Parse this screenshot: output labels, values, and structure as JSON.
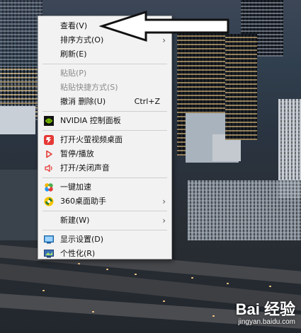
{
  "context_menu": {
    "items": [
      {
        "label": "查看(V)"
      },
      {
        "label": "排序方式(O)"
      },
      {
        "label": "刷新(E)"
      },
      {
        "label": "粘贴(P)"
      },
      {
        "label": "粘贴快捷方式(S)"
      },
      {
        "label": "撤消 删除(U)",
        "shortcut": "Ctrl+Z"
      },
      {
        "label": "NVIDIA 控制面板"
      },
      {
        "label": "打开火萤视频桌面"
      },
      {
        "label": "暂停/播放"
      },
      {
        "label": "打开/关闭声音"
      },
      {
        "label": "一键加速"
      },
      {
        "label": "360桌面助手"
      },
      {
        "label": "新建(W)"
      },
      {
        "label": "显示设置(D)"
      },
      {
        "label": "个性化(R)"
      }
    ],
    "submenu_glyph": "›"
  },
  "watermark": {
    "logo_text": "Bai 经验",
    "url": "jingyan.baidu.com"
  },
  "colors": {
    "menu_bg": "#f2f2f2",
    "disabled_text": "#8a8a8a",
    "nvidia_green": "#76b900",
    "firefly_red": "#e53935"
  }
}
